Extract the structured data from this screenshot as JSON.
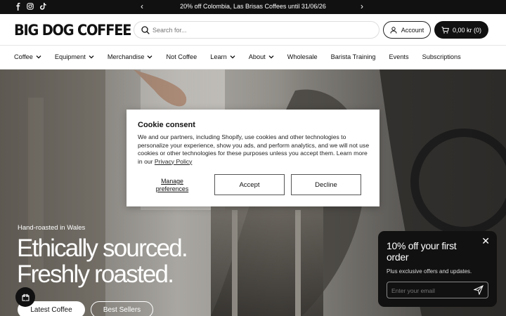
{
  "announcement": {
    "message": "20% off Colombia, Las Brisas Coffees until 31/06/26",
    "prev": "‹",
    "next": "›",
    "socials": [
      "facebook-icon",
      "instagram-icon",
      "tiktok-icon"
    ]
  },
  "header": {
    "logo": "BIG DOG COFFEE",
    "search_placeholder": "Search for...",
    "account_label": "Account",
    "cart_label": "0,00 kr (0)"
  },
  "nav": {
    "items": [
      {
        "label": "Coffee",
        "dropdown": true
      },
      {
        "label": "Equipment",
        "dropdown": true
      },
      {
        "label": "Merchandise",
        "dropdown": true
      },
      {
        "label": "Not Coffee",
        "dropdown": false
      },
      {
        "label": "Learn",
        "dropdown": true
      },
      {
        "label": "About",
        "dropdown": true
      },
      {
        "label": "Wholesale",
        "dropdown": false
      },
      {
        "label": "Barista Training",
        "dropdown": false
      },
      {
        "label": "Events",
        "dropdown": false
      },
      {
        "label": "Subscriptions",
        "dropdown": false
      }
    ]
  },
  "hero": {
    "tagline": "Hand-roasted in Wales",
    "headline_1": "Ethically sourced.",
    "headline_2": "Freshly roasted.",
    "btn_latest": "Latest Coffee",
    "btn_best": "Best Sellers"
  },
  "cookie": {
    "title": "Cookie consent",
    "body": "We and our partners, including Shopify, use cookies and other technologies to personalize your experience, show you ads, and perform analytics, and we will not use cookies or other technologies for these purposes unless you accept them. Learn more in our ",
    "policy_link": "Privacy Policy",
    "manage": "Manage preferences",
    "accept": "Accept",
    "decline": "Decline"
  },
  "promo": {
    "title": "10% off your first order",
    "subtitle": "Plus exclusive offers and updates.",
    "email_placeholder": "Enter your email",
    "close": "✕"
  },
  "colors": {
    "brand_dark": "#111111",
    "white": "#ffffff"
  }
}
